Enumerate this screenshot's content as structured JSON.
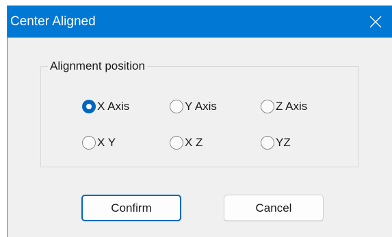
{
  "window": {
    "title": "Center Aligned",
    "accent_color": "#0078d4"
  },
  "group": {
    "legend": "Alignment position",
    "options": [
      {
        "label": "X Axis",
        "checked": true
      },
      {
        "label": "Y Axis",
        "checked": false
      },
      {
        "label": "Z Axis",
        "checked": false
      },
      {
        "label": "X Y",
        "checked": false
      },
      {
        "label": "X Z",
        "checked": false
      },
      {
        "label": "YZ",
        "checked": false
      }
    ]
  },
  "buttons": {
    "confirm_label": "Confirm",
    "cancel_label": "Cancel"
  },
  "icons": {
    "close": "close-icon"
  }
}
